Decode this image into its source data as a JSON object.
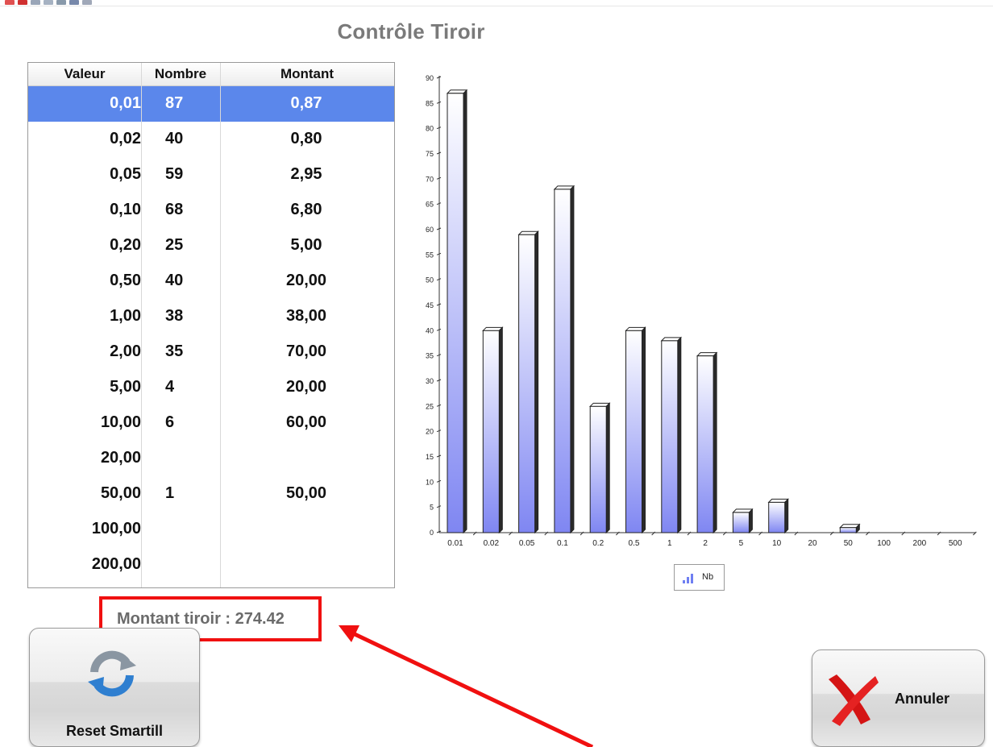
{
  "window": {
    "title": "Contrôle Tiroir"
  },
  "table": {
    "headers": [
      "Valeur",
      "Nombre",
      "Montant"
    ],
    "rows": [
      {
        "valeur": "0,01",
        "nombre": "87",
        "montant": "0,87",
        "selected": true
      },
      {
        "valeur": "0,02",
        "nombre": "40",
        "montant": "0,80"
      },
      {
        "valeur": "0,05",
        "nombre": "59",
        "montant": "2,95"
      },
      {
        "valeur": "0,10",
        "nombre": "68",
        "montant": "6,80"
      },
      {
        "valeur": "0,20",
        "nombre": "25",
        "montant": "5,00"
      },
      {
        "valeur": "0,50",
        "nombre": "40",
        "montant": "20,00"
      },
      {
        "valeur": "1,00",
        "nombre": "38",
        "montant": "38,00"
      },
      {
        "valeur": "2,00",
        "nombre": "35",
        "montant": "70,00"
      },
      {
        "valeur": "5,00",
        "nombre": "4",
        "montant": "20,00"
      },
      {
        "valeur": "10,00",
        "nombre": "6",
        "montant": "60,00"
      },
      {
        "valeur": "20,00",
        "nombre": "",
        "montant": ""
      },
      {
        "valeur": "50,00",
        "nombre": "1",
        "montant": "50,00"
      },
      {
        "valeur": "100,00",
        "nombre": "",
        "montant": ""
      },
      {
        "valeur": "200,00",
        "nombre": "",
        "montant": ""
      }
    ]
  },
  "chart_data": {
    "type": "bar",
    "categories": [
      "0.01",
      "0.02",
      "0.05",
      "0.1",
      "0.2",
      "0.5",
      "1",
      "2",
      "5",
      "10",
      "20",
      "50",
      "100",
      "200",
      "500"
    ],
    "series": [
      {
        "name": "Nb",
        "values": [
          87,
          40,
          59,
          68,
          25,
          40,
          38,
          35,
          4,
          6,
          0,
          1,
          0,
          0,
          0
        ]
      }
    ],
    "ylim": [
      0,
      90
    ],
    "yticks": [
      0,
      5,
      10,
      15,
      20,
      25,
      30,
      35,
      40,
      45,
      50,
      55,
      60,
      65,
      70,
      75,
      80,
      85,
      90
    ],
    "legend_position": "bottom-center",
    "grid": false
  },
  "total": {
    "text": "Montant tiroir : 274.42"
  },
  "buttons": {
    "reset_label": "Reset Smartill",
    "cancel_label": "Annuler"
  },
  "colors": {
    "selection": "#5b87eb",
    "bar": "#7f86f2",
    "highlight": "#f01010"
  }
}
